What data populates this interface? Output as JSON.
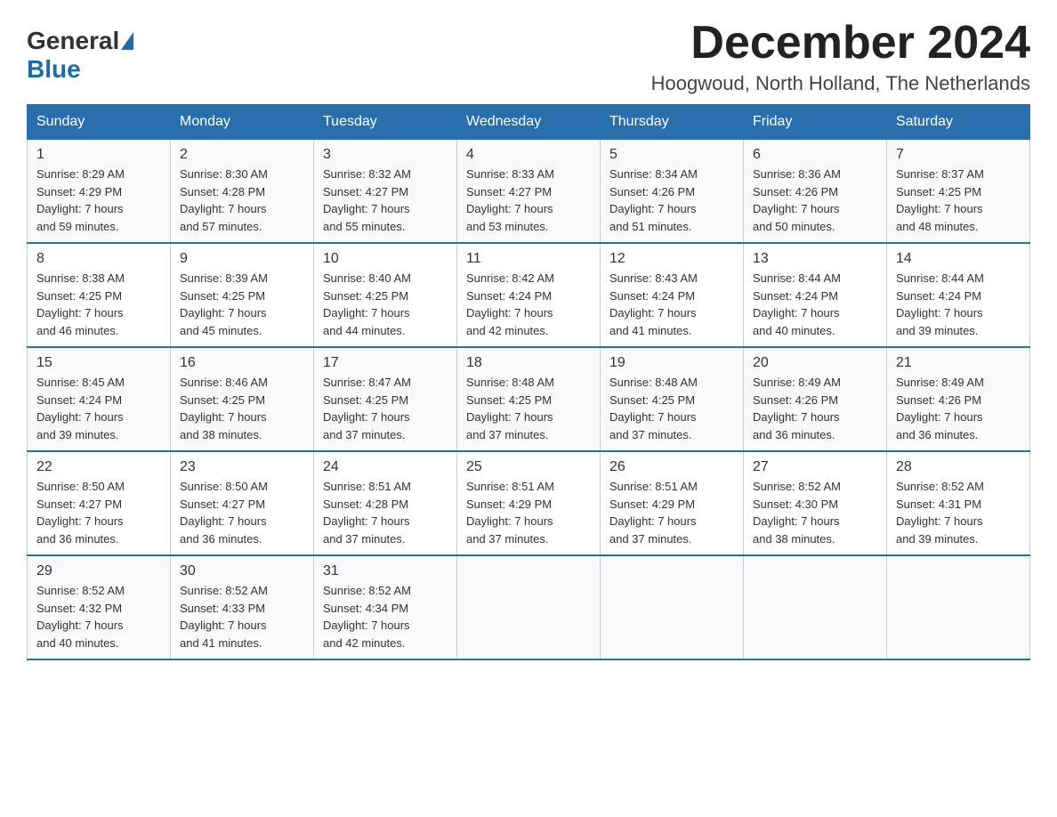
{
  "header": {
    "logo_general": "General",
    "logo_blue": "Blue",
    "month_title": "December 2024",
    "location": "Hoogwoud, North Holland, The Netherlands"
  },
  "days_of_week": [
    "Sunday",
    "Monday",
    "Tuesday",
    "Wednesday",
    "Thursday",
    "Friday",
    "Saturday"
  ],
  "weeks": [
    [
      {
        "day": "1",
        "sunrise": "8:29 AM",
        "sunset": "4:29 PM",
        "daylight": "7 hours and 59 minutes."
      },
      {
        "day": "2",
        "sunrise": "8:30 AM",
        "sunset": "4:28 PM",
        "daylight": "7 hours and 57 minutes."
      },
      {
        "day": "3",
        "sunrise": "8:32 AM",
        "sunset": "4:27 PM",
        "daylight": "7 hours and 55 minutes."
      },
      {
        "day": "4",
        "sunrise": "8:33 AM",
        "sunset": "4:27 PM",
        "daylight": "7 hours and 53 minutes."
      },
      {
        "day": "5",
        "sunrise": "8:34 AM",
        "sunset": "4:26 PM",
        "daylight": "7 hours and 51 minutes."
      },
      {
        "day": "6",
        "sunrise": "8:36 AM",
        "sunset": "4:26 PM",
        "daylight": "7 hours and 50 minutes."
      },
      {
        "day": "7",
        "sunrise": "8:37 AM",
        "sunset": "4:25 PM",
        "daylight": "7 hours and 48 minutes."
      }
    ],
    [
      {
        "day": "8",
        "sunrise": "8:38 AM",
        "sunset": "4:25 PM",
        "daylight": "7 hours and 46 minutes."
      },
      {
        "day": "9",
        "sunrise": "8:39 AM",
        "sunset": "4:25 PM",
        "daylight": "7 hours and 45 minutes."
      },
      {
        "day": "10",
        "sunrise": "8:40 AM",
        "sunset": "4:25 PM",
        "daylight": "7 hours and 44 minutes."
      },
      {
        "day": "11",
        "sunrise": "8:42 AM",
        "sunset": "4:24 PM",
        "daylight": "7 hours and 42 minutes."
      },
      {
        "day": "12",
        "sunrise": "8:43 AM",
        "sunset": "4:24 PM",
        "daylight": "7 hours and 41 minutes."
      },
      {
        "day": "13",
        "sunrise": "8:44 AM",
        "sunset": "4:24 PM",
        "daylight": "7 hours and 40 minutes."
      },
      {
        "day": "14",
        "sunrise": "8:44 AM",
        "sunset": "4:24 PM",
        "daylight": "7 hours and 39 minutes."
      }
    ],
    [
      {
        "day": "15",
        "sunrise": "8:45 AM",
        "sunset": "4:24 PM",
        "daylight": "7 hours and 39 minutes."
      },
      {
        "day": "16",
        "sunrise": "8:46 AM",
        "sunset": "4:25 PM",
        "daylight": "7 hours and 38 minutes."
      },
      {
        "day": "17",
        "sunrise": "8:47 AM",
        "sunset": "4:25 PM",
        "daylight": "7 hours and 37 minutes."
      },
      {
        "day": "18",
        "sunrise": "8:48 AM",
        "sunset": "4:25 PM",
        "daylight": "7 hours and 37 minutes."
      },
      {
        "day": "19",
        "sunrise": "8:48 AM",
        "sunset": "4:25 PM",
        "daylight": "7 hours and 37 minutes."
      },
      {
        "day": "20",
        "sunrise": "8:49 AM",
        "sunset": "4:26 PM",
        "daylight": "7 hours and 36 minutes."
      },
      {
        "day": "21",
        "sunrise": "8:49 AM",
        "sunset": "4:26 PM",
        "daylight": "7 hours and 36 minutes."
      }
    ],
    [
      {
        "day": "22",
        "sunrise": "8:50 AM",
        "sunset": "4:27 PM",
        "daylight": "7 hours and 36 minutes."
      },
      {
        "day": "23",
        "sunrise": "8:50 AM",
        "sunset": "4:27 PM",
        "daylight": "7 hours and 36 minutes."
      },
      {
        "day": "24",
        "sunrise": "8:51 AM",
        "sunset": "4:28 PM",
        "daylight": "7 hours and 37 minutes."
      },
      {
        "day": "25",
        "sunrise": "8:51 AM",
        "sunset": "4:29 PM",
        "daylight": "7 hours and 37 minutes."
      },
      {
        "day": "26",
        "sunrise": "8:51 AM",
        "sunset": "4:29 PM",
        "daylight": "7 hours and 37 minutes."
      },
      {
        "day": "27",
        "sunrise": "8:52 AM",
        "sunset": "4:30 PM",
        "daylight": "7 hours and 38 minutes."
      },
      {
        "day": "28",
        "sunrise": "8:52 AM",
        "sunset": "4:31 PM",
        "daylight": "7 hours and 39 minutes."
      }
    ],
    [
      {
        "day": "29",
        "sunrise": "8:52 AM",
        "sunset": "4:32 PM",
        "daylight": "7 hours and 40 minutes."
      },
      {
        "day": "30",
        "sunrise": "8:52 AM",
        "sunset": "4:33 PM",
        "daylight": "7 hours and 41 minutes."
      },
      {
        "day": "31",
        "sunrise": "8:52 AM",
        "sunset": "4:34 PM",
        "daylight": "7 hours and 42 minutes."
      },
      null,
      null,
      null,
      null
    ]
  ],
  "labels": {
    "sunrise": "Sunrise:",
    "sunset": "Sunset:",
    "daylight": "Daylight:"
  }
}
